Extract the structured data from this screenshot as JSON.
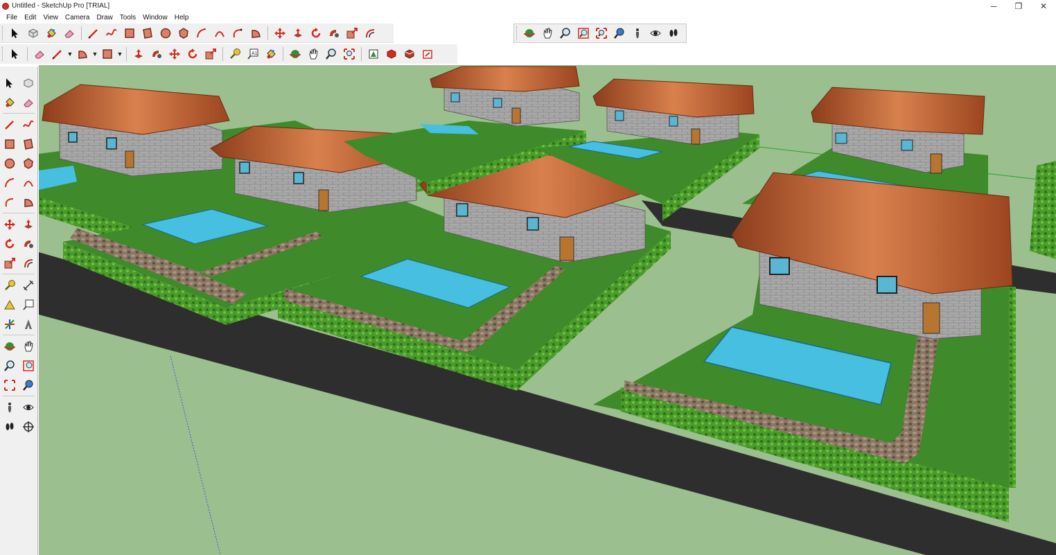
{
  "window": {
    "title": "Untitled - SketchUp Pro [TRIAL]",
    "minimize_glyph": "─",
    "maximize_glyph": "❐",
    "close_glyph": "✕"
  },
  "menu": {
    "items": [
      "File",
      "Edit",
      "View",
      "Camera",
      "Draw",
      "Tools",
      "Window",
      "Help"
    ]
  },
  "toolbar_top": {
    "icons": [
      "select-icon",
      "make-component-icon",
      "paint-bucket-icon",
      "eraser-icon",
      "pencil-line-icon",
      "freehand-icon",
      "rectangle-icon",
      "rotated-rectangle-icon",
      "circle-icon",
      "polygon-icon",
      "arc-icon",
      "two-point-arc-icon",
      "three-point-arc-icon",
      "pie-icon",
      "move-icon",
      "push-pull-icon",
      "rotate-icon",
      "follow-me-icon",
      "scale-icon",
      "offset-icon"
    ],
    "camera_icons": [
      "orbit-icon",
      "pan-icon",
      "zoom-icon",
      "zoom-window-icon",
      "zoom-extents-icon",
      "previous-view-icon",
      "position-camera-icon",
      "look-around-icon",
      "walk-icon"
    ]
  },
  "toolbar_large": {
    "icons": [
      "select-icon",
      "eraser-icon",
      "line-icon",
      "arc-dropdown-icon",
      "rectangle-dropdown-icon",
      "push-pull-icon",
      "follow-me-icon",
      "move-icon",
      "rotate-icon",
      "scale-icon",
      "tape-measure-icon",
      "text-icon",
      "paint-bucket-icon",
      "orbit-icon",
      "pan-icon",
      "zoom-icon",
      "zoom-extents-icon",
      "3d-warehouse-icon",
      "extension-warehouse-icon",
      "layout-icon",
      "send-to-layout-icon"
    ]
  },
  "toolbar_left": {
    "icons": [
      "select-icon",
      "make-component-icon",
      "paint-bucket-icon",
      "eraser-icon",
      "line-icon",
      "freehand-icon",
      "rectangle-icon",
      "rotated-rectangle-icon",
      "circle-icon",
      "polygon-icon",
      "arc-icon",
      "two-point-arc-icon",
      "three-point-arc-icon",
      "pie-icon",
      "move-icon",
      "push-pull-icon",
      "rotate-icon",
      "follow-me-icon",
      "scale-icon",
      "offset-icon",
      "tape-measure-icon",
      "dimension-icon",
      "protractor-icon",
      "text-icon",
      "axes-icon",
      "3d-text-icon",
      "orbit-icon",
      "pan-icon",
      "zoom-icon",
      "zoom-window-icon",
      "zoom-extents-icon",
      "previous-view-icon",
      "position-camera-icon",
      "look-around-icon",
      "walk-icon",
      "section-plane-icon"
    ]
  },
  "colors": {
    "ground": "#9cbf8f",
    "road": "#2e2e2e",
    "grass": "#3f8a2a",
    "hedge": "#4b9a2c",
    "wall": "#a6a6a6",
    "roof": "#b5562a",
    "pool": "#46bfe0",
    "stone_path": "#8a7663",
    "door": "#b8752f",
    "accent_red": "#d42a1f"
  }
}
